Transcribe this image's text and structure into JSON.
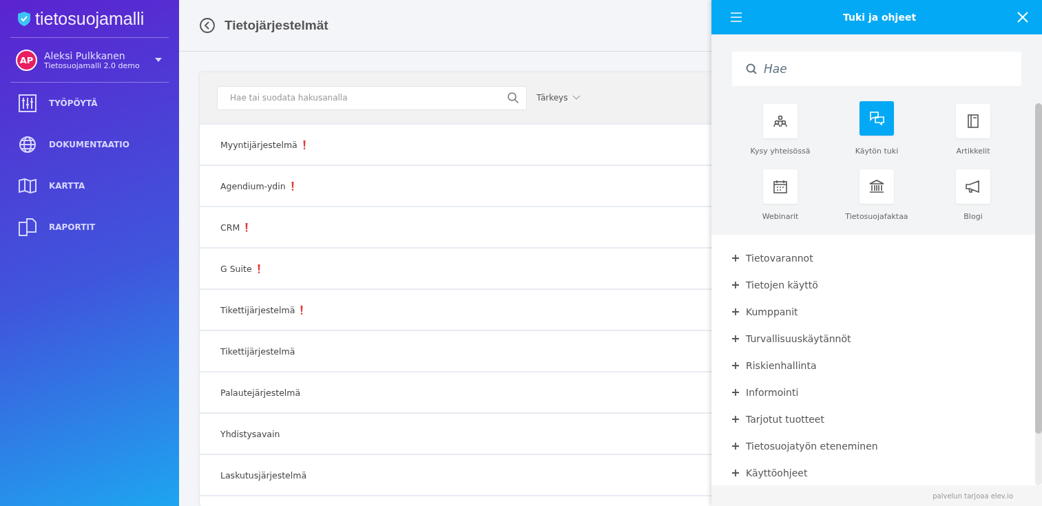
{
  "sidebar": {
    "logo": "tietosuojamalli",
    "user": {
      "initials": "AP",
      "name": "Aleksi Pulkkanen",
      "org": "Tietosuojamalli 2.0 demo"
    },
    "nav": [
      {
        "label": "TYÖPÖYTÄ"
      },
      {
        "label": "DOKUMENTAATIO"
      },
      {
        "label": "KARTTA"
      },
      {
        "label": "RAPORTIT"
      }
    ]
  },
  "header": {
    "title": "Tietojärjestelmät"
  },
  "filter": {
    "placeholder": "Hae tai suodata hakusanalla",
    "sort": "Tärkeys"
  },
  "systems": [
    {
      "name": "Myyntijärjestelmä",
      "flagged": true
    },
    {
      "name": "Agendium-ydin",
      "flagged": true
    },
    {
      "name": "CRM",
      "flagged": true
    },
    {
      "name": "G Suite",
      "flagged": true
    },
    {
      "name": "Tikettijärjestelmä",
      "flagged": true
    },
    {
      "name": "Tikettijärjestelmä",
      "flagged": false
    },
    {
      "name": "Palautejärjestelmä",
      "flagged": false
    },
    {
      "name": "Yhdistysavain",
      "flagged": false
    },
    {
      "name": "Laskutusjärjestelmä",
      "flagged": false
    }
  ],
  "help": {
    "title": "Tuki ja ohjeet",
    "search": {
      "placeholder": "Hae"
    },
    "tiles": [
      {
        "label": "Kysy yhteisössä",
        "selected": false
      },
      {
        "label": "Käytön tuki",
        "selected": true
      },
      {
        "label": "Artikkelit",
        "selected": false
      },
      {
        "label": "Webinarit",
        "selected": false
      },
      {
        "label": "Tietosuojafaktaa",
        "selected": false
      },
      {
        "label": "Blogi",
        "selected": false
      }
    ],
    "topics": [
      {
        "label": "Tietovarannot",
        "expanded": false
      },
      {
        "label": "Tietojen käyttö",
        "expanded": false
      },
      {
        "label": "Kumppanit",
        "expanded": false
      },
      {
        "label": "Turvallisuuskäytännöt",
        "expanded": false
      },
      {
        "label": "Riskienhallinta",
        "expanded": false
      },
      {
        "label": "Informointi",
        "expanded": false
      },
      {
        "label": "Tarjotut tuotteet",
        "expanded": false
      },
      {
        "label": "Tietosuojatyön eteneminen",
        "expanded": false
      },
      {
        "label": "Käyttöohjeet",
        "expanded": false
      }
    ],
    "footer": "palvelun tarjoaa elev.io"
  }
}
